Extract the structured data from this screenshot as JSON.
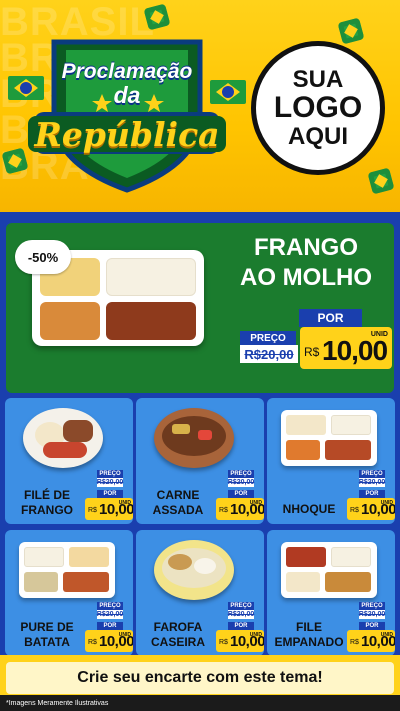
{
  "header": {
    "bg_word": "BRASIL",
    "emblem": {
      "line1": "Proclamação",
      "line2": "da",
      "line3": "República"
    },
    "logo": {
      "line1": "SUA",
      "line2": "LOGO",
      "line3": "AQUI"
    }
  },
  "featured": {
    "discount": "-50%",
    "title_line1": "FRANGO",
    "title_line2": "AO MOLHO",
    "price": {
      "preco_label": "PREÇO",
      "old_price": "R$20,00",
      "por_label": "POR",
      "currency": "R$",
      "value": "10,00",
      "unit": "UNID"
    }
  },
  "items": [
    {
      "name_line1": "FILÉ DE",
      "name_line2": "FRANGO",
      "preco_label": "PREÇO",
      "old_price": "R$20,00",
      "por_label": "POR",
      "currency": "R$",
      "value": "10,00",
      "unit": "UNID"
    },
    {
      "name_line1": "CARNE",
      "name_line2": "ASSADA",
      "preco_label": "PREÇO",
      "old_price": "R$20,00",
      "por_label": "POR",
      "currency": "R$",
      "value": "10,00",
      "unit": "UNID"
    },
    {
      "name_line1": "NHOQUE",
      "name_line2": "",
      "preco_label": "PREÇO",
      "old_price": "R$20,00",
      "por_label": "POR",
      "currency": "R$",
      "value": "10,00",
      "unit": "UNID"
    },
    {
      "name_line1": "PURE DE",
      "name_line2": "BATATA",
      "preco_label": "PREÇO",
      "old_price": "R$20,00",
      "por_label": "POR",
      "currency": "R$",
      "value": "10,00",
      "unit": "UNID"
    },
    {
      "name_line1": "FAROFA",
      "name_line2": "CASEIRA",
      "preco_label": "PREÇO",
      "old_price": "R$20,00",
      "por_label": "POR",
      "currency": "R$",
      "value": "10,00",
      "unit": "UNID"
    },
    {
      "name_line1": "FILE",
      "name_line2": "EMPANADO",
      "preco_label": "PREÇO",
      "old_price": "R$20,00",
      "por_label": "POR",
      "currency": "R$",
      "value": "10,00",
      "unit": "UNID"
    }
  ],
  "cta": {
    "label": "Crie seu encarte com este tema!"
  },
  "disclaimer": "*Imagens Meramente Ilustrativas",
  "colors": {
    "blue": "#1a3fae",
    "green": "#1b7c2e",
    "yellow": "#ffd21a",
    "card": "#3d8fe4"
  }
}
